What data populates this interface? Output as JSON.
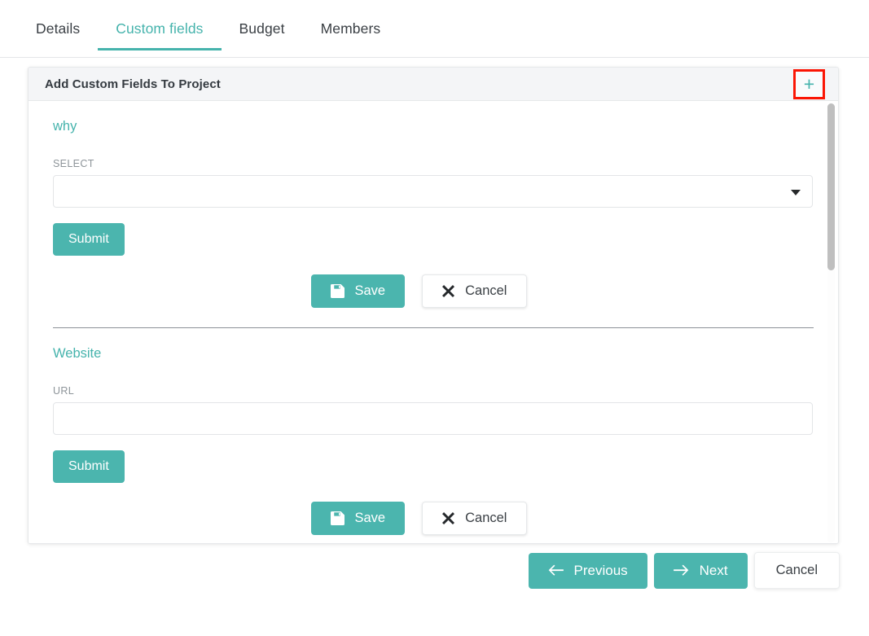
{
  "tabs": [
    {
      "label": "Details",
      "active": false
    },
    {
      "label": "Custom fields",
      "active": true
    },
    {
      "label": "Budget",
      "active": false
    },
    {
      "label": "Members",
      "active": false
    }
  ],
  "card": {
    "title": "Add Custom Fields To Project",
    "add_button_label": "+",
    "add_button_icon": "plus-icon",
    "highlight_color": "#fb1605"
  },
  "fields": [
    {
      "name": "why",
      "input_label": "SELECT",
      "input_type": "select",
      "value": "",
      "placeholder": "",
      "submit_label": "Submit",
      "save_label": "Save",
      "save_icon": "save-floppy-icon",
      "cancel_label": "Cancel",
      "cancel_icon": "close-x-icon"
    },
    {
      "name": "Website",
      "input_label": "URL",
      "input_type": "text",
      "value": "",
      "placeholder": "",
      "submit_label": "Submit",
      "save_label": "Save",
      "save_icon": "save-floppy-icon",
      "cancel_label": "Cancel",
      "cancel_icon": "close-x-icon"
    }
  ],
  "footer": {
    "previous_label": "Previous",
    "previous_icon": "arrow-left-icon",
    "next_label": "Next",
    "next_icon": "arrow-right-icon",
    "cancel_label": "Cancel"
  },
  "theme": {
    "accent": "#4bb5ae",
    "accent_text": "#45b3ac",
    "header_bg": "#f4f5f7"
  }
}
